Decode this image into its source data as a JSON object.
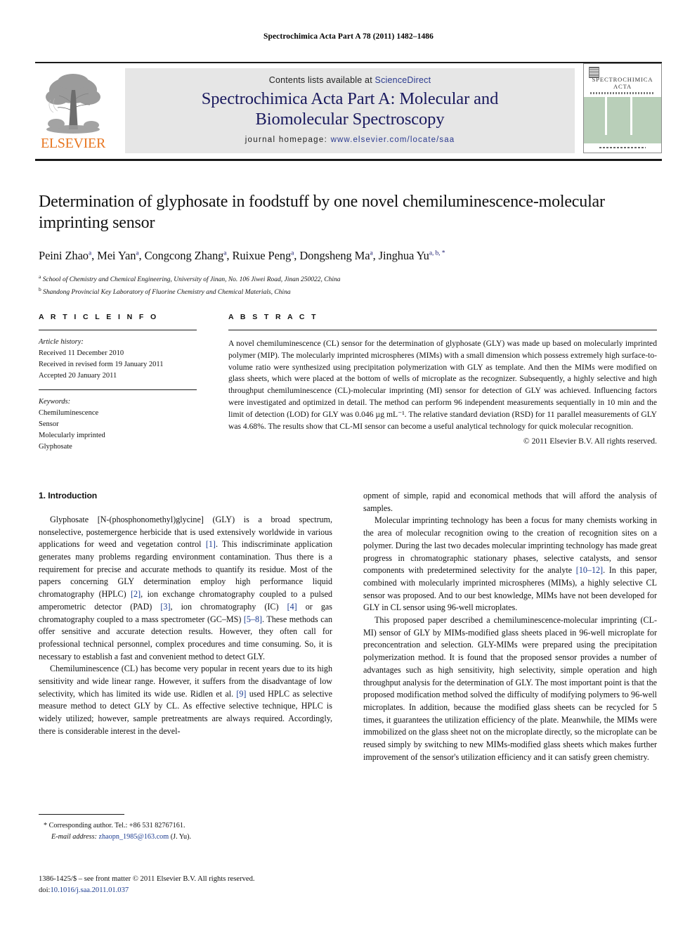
{
  "running_head": "Spectrochimica Acta Part A 78 (2011) 1482–1486",
  "masthead": {
    "publisher_name": "ELSEVIER",
    "contents_prefix": "Contents lists available at ",
    "contents_link": "ScienceDirect",
    "journal_title_line1": "Spectrochimica Acta Part A: Molecular and",
    "journal_title_line2": "Biomolecular Spectroscopy",
    "homepage_prefix": "journal homepage: ",
    "homepage_link": "www.elsevier.com/locate/saa",
    "cover": {
      "line1": "SPECTROCHIMICA",
      "line2": "ACTA"
    }
  },
  "article": {
    "title": "Determination of glyphosate in foodstuff by one novel chemiluminescence-molecular imprinting sensor",
    "authors_html": "Peini Zhao, Mei Yan, Congcong Zhang, Ruixue Peng, Dongsheng Ma, Jinghua Yu",
    "authors": [
      {
        "name": "Peini Zhao",
        "sup": "a"
      },
      {
        "name": "Mei Yan",
        "sup": "a"
      },
      {
        "name": "Congcong Zhang",
        "sup": "a"
      },
      {
        "name": "Ruixue Peng",
        "sup": "a"
      },
      {
        "name": "Dongsheng Ma",
        "sup": "a"
      },
      {
        "name": "Jinghua Yu",
        "sup": "a, b, *"
      }
    ],
    "affiliations": [
      {
        "marker": "a",
        "text": "School of Chemistry and Chemical Engineering, University of Jinan, No. 106 Jiwei Road, Jinan 250022, China"
      },
      {
        "marker": "b",
        "text": "Shandong Provincial Key Laboratory of Fluorine Chemistry and Chemical Materials, China"
      }
    ]
  },
  "article_info": {
    "heading": "A R T I C L E   I N F O",
    "history_label": "Article history:",
    "history": [
      "Received 11 December 2010",
      "Received in revised form 19 January 2011",
      "Accepted 20 January 2011"
    ],
    "keywords_label": "Keywords:",
    "keywords": [
      "Chemiluminescence",
      "Sensor",
      "Molecularly imprinted",
      "Glyphosate"
    ]
  },
  "abstract": {
    "heading": "A B S T R A C T",
    "text": "A novel chemiluminescence (CL) sensor for the determination of glyphosate (GLY) was made up based on molecularly imprinted polymer (MIP). The molecularly imprinted microspheres (MIMs) with a small dimension which possess extremely high surface-to-volume ratio were synthesized using precipitation polymerization with GLY as template. And then the MIMs were modified on glass sheets, which were placed at the bottom of wells of microplate as the recognizer. Subsequently, a highly selective and high throughput chemiluminescence (CL)-molecular imprinting (MI) sensor for detection of GLY was achieved. Influencing factors were investigated and optimized in detail. The method can perform 96 independent measurements sequentially in 10 min and the limit of detection (LOD) for GLY was 0.046 µg mL⁻¹. The relative standard deviation (RSD) for 11 parallel measurements of GLY was 4.68%. The results show that CL-MI sensor can become a useful analytical technology for quick molecular recognition.",
    "copyright": "© 2011 Elsevier B.V. All rights reserved."
  },
  "body": {
    "section_number_title": "1. Introduction",
    "left_paragraphs": [
      "Glyphosate [N-(phosphonomethyl)glycine] (GLY) is a broad spectrum, nonselective, postemergence herbicide that is used extensively worldwide in various applications for weed and vegetation control [1]. This indiscriminate application generates many problems regarding environment contamination. Thus there is a requirement for precise and accurate methods to quantify its residue. Most of the papers concerning GLY determination employ high performance liquid chromatography (HPLC) [2], ion exchange chromatography coupled to a pulsed amperometric detector (PAD) [3], ion chromatography (IC) [4] or gas chromatography coupled to a mass spectrometer (GC–MS) [5–8]. These methods can offer sensitive and accurate detection results. However, they often call for professional technical personnel, complex procedures and time consuming. So, it is necessary to establish a fast and convenient method to detect GLY.",
      "Chemiluminescence (CL) has become very popular in recent years due to its high sensitivity and wide linear range. However, it suffers from the disadvantage of low selectivity, which has limited its wide use. Ridlen et al. [9] used HPLC as selective measure method to detect GLY by CL. As effective selective technique, HPLC is widely utilized; however, sample pretreatments are always required. Accordingly, there is considerable interest in the devel-"
    ],
    "right_paragraphs": [
      "opment of simple, rapid and economical methods that will afford the analysis of samples.",
      "Molecular imprinting technology has been a focus for many chemists working in the area of molecular recognition owing to the creation of recognition sites on a polymer. During the last two decades molecular imprinting technology has made great progress in chromatographic stationary phases, selective catalysts, and sensor components with predetermined selectivity for the analyte [10–12]. In this paper, combined with molecularly imprinted microspheres (MIMs), a highly selective CL sensor was proposed. And to our best knowledge, MIMs have not been developed for GLY in CL sensor using 96-well microplates.",
      "This proposed paper described a chemiluminescence-molecular imprinting (CL-MI) sensor of GLY by MIMs-modified glass sheets placed in 96-well microplate for preconcentration and selection. GLY-MIMs were prepared using the precipitation polymerization method. It is found that the proposed sensor provides a number of advantages such as high sensitivity, high selectivity, simple operation and high throughput analysis for the determination of GLY. The most important point is that the proposed modification method solved the difficulty of modifying polymers to 96-well microplates. In addition, because the modified glass sheets can be recycled for 5 times, it guarantees the utilization efficiency of the plate. Meanwhile, the MIMs were immobilized on the glass sheet not on the microplate directly, so the microplate can be reused simply by switching to new MIMs-modified glass sheets which makes further improvement of the sensor's utilization efficiency and it can satisfy green chemistry."
    ]
  },
  "footnotes": {
    "corresponding": "* Corresponding author. Tel.: +86 531 82767161.",
    "email_label": "E-mail address:",
    "email": "zhaopn_1985@163.com",
    "email_suffix": "(J. Yu)."
  },
  "imprint": {
    "line1": "1386-1425/$ – see front matter © 2011 Elsevier B.V. All rights reserved.",
    "doi_label": "doi:",
    "doi": "10.1016/j.saa.2011.01.037"
  },
  "colors": {
    "link": "#1a3a8f",
    "journal_title": "#1a1a5e",
    "elsevier_orange": "#E87722",
    "banner_bg": "#e6e6e6",
    "cover_band": "#b9cfb9"
  }
}
